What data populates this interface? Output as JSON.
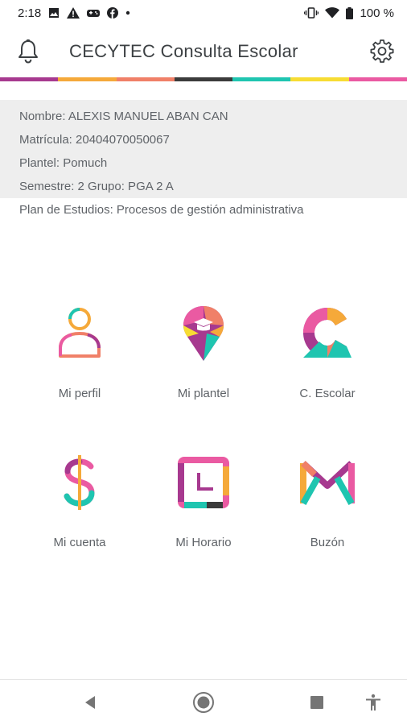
{
  "status_bar": {
    "time": "2:18",
    "battery": "100 %"
  },
  "app_bar": {
    "title": "CECYTEC Consulta Escolar"
  },
  "colors": {
    "strip": [
      "#a7398f",
      "#f5a93a",
      "#f08068",
      "#3b3b3b",
      "#1fc5b0",
      "#f7dc33",
      "#ea5aa2"
    ],
    "info_bg": "#eeeeee"
  },
  "student": {
    "nombre": "Nombre: ALEXIS MANUEL ABAN CAN",
    "matricula": "Matrícula: 20404070050067",
    "plantel": "Plantel: Pomuch",
    "semestre": "Semestre: 2 Grupo: PGA 2 A",
    "plan": "Plan de Estudios: Procesos de gestión administrativa"
  },
  "menu": {
    "items": [
      {
        "label": "Mi perfil",
        "icon": "person-icon"
      },
      {
        "label": "Mi plantel",
        "icon": "location-pin-icon"
      },
      {
        "label": "C. Escolar",
        "icon": "letter-c-icon"
      },
      {
        "label": "Mi cuenta",
        "icon": "dollar-icon"
      },
      {
        "label": "Mi Horario",
        "icon": "schedule-icon"
      },
      {
        "label": "Buzón",
        "icon": "mail-icon"
      }
    ]
  }
}
